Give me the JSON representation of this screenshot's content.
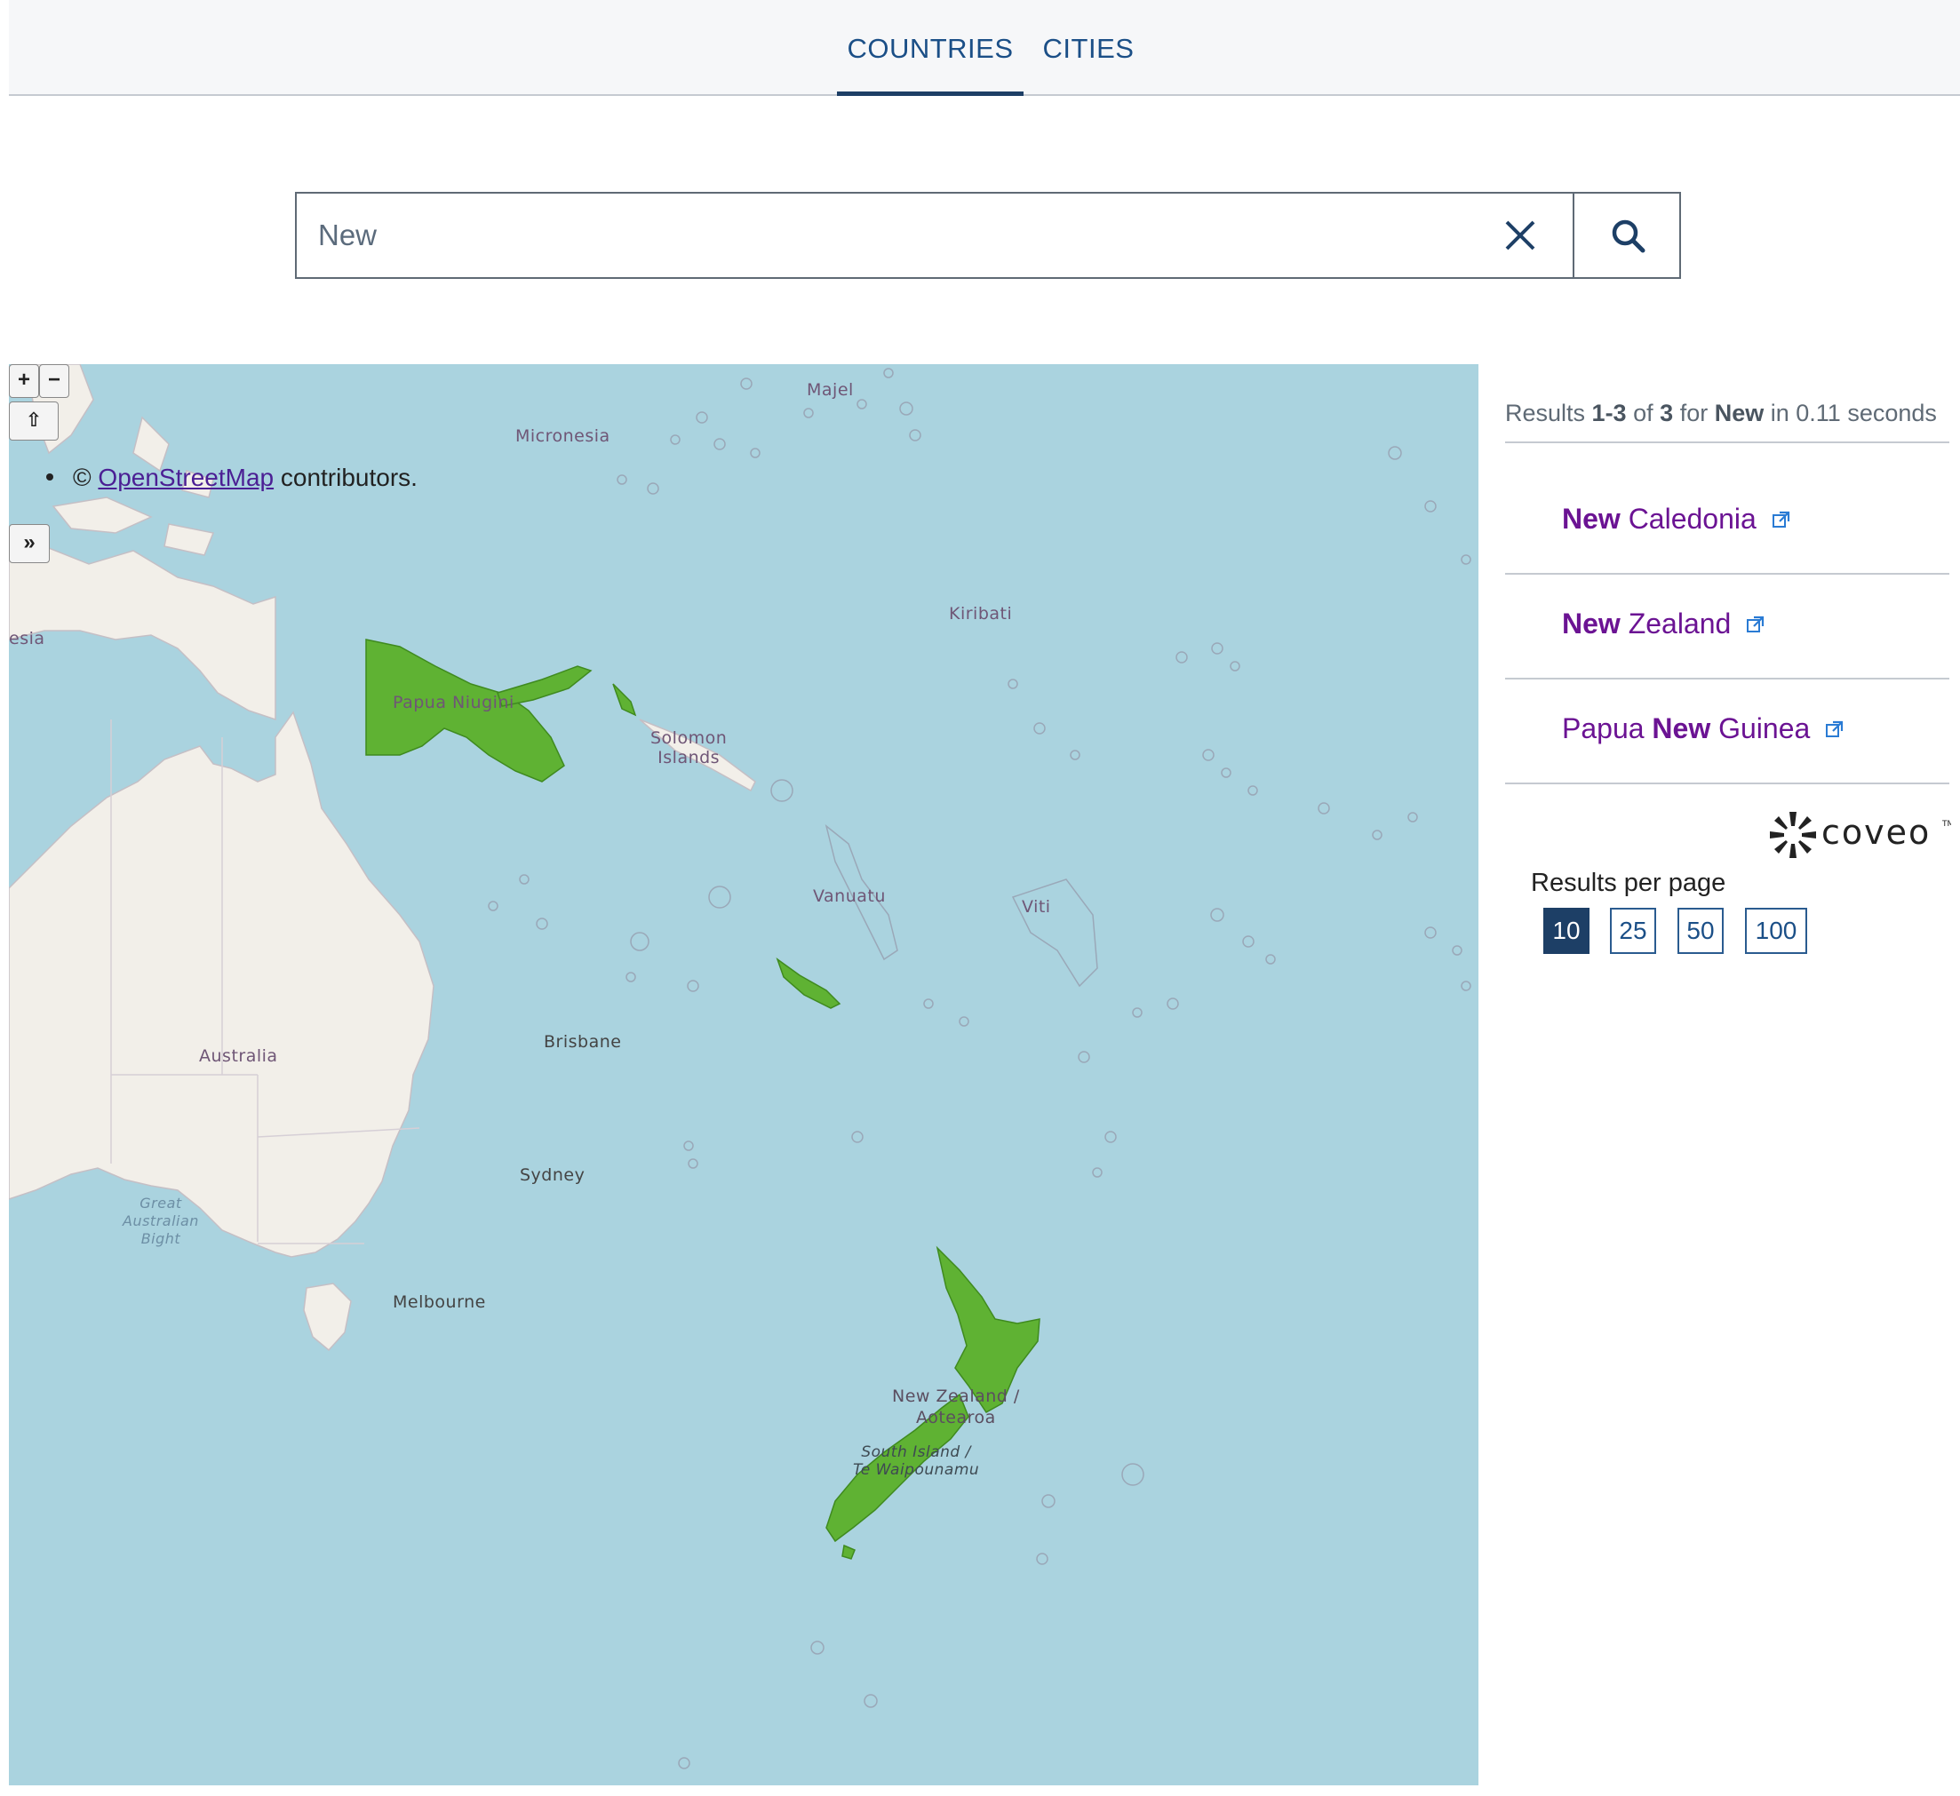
{
  "tabs": [
    {
      "label": "COUNTRIES",
      "active": true
    },
    {
      "label": "CITIES",
      "active": false
    }
  ],
  "search": {
    "value": "New",
    "placeholder": ""
  },
  "map": {
    "controls": {
      "zoom_in": "+",
      "zoom_out": "−",
      "home": "⇧",
      "expand": "»"
    },
    "attribution": {
      "prefix": "©",
      "link_text": "OpenStreetMap",
      "suffix": "contributors."
    },
    "labels": {
      "micronesia": "Micronesia",
      "majel": "Majel",
      "kiribati": "Kiribati",
      "papua": "Papua Niugini",
      "solomon": "Solomon\nIslands",
      "vanuatu": "Vanuatu",
      "viti": "Viti",
      "australia": "Australia",
      "brisbane": "Brisbane",
      "sydney": "Sydney",
      "melbourne": "Melbourne",
      "bight": "Great\nAustralian\nBight",
      "nz": "New Zealand /\nAotearoa",
      "south_island": "South Island /\nTe Waipounamu",
      "esia": "esia"
    },
    "highlight_color": "#5fb233"
  },
  "results": {
    "summary": {
      "prefix": "Results",
      "range": "1-3",
      "of": "of",
      "total": "3",
      "for": "for",
      "query": "New",
      "in": "in 0.11 seconds"
    },
    "items": [
      {
        "bold": "New",
        "rest": " Caledonia",
        "lead": ""
      },
      {
        "bold": "New",
        "rest": " Zealand",
        "lead": ""
      },
      {
        "lead": "Papua ",
        "bold": "New",
        "rest": " Guinea"
      }
    ],
    "brand": "coveo",
    "per_page_label": "Results per page",
    "per_page_options": [
      "10",
      "25",
      "50",
      "100"
    ],
    "per_page_selected": "10"
  }
}
